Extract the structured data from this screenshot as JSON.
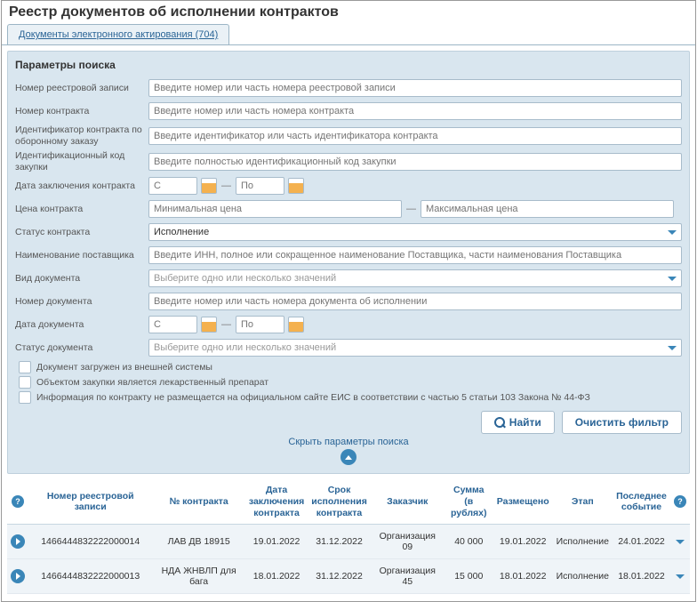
{
  "title": "Реестр документов об исполнении контрактов",
  "tab": "Документы электронного актирования (704)",
  "panel": {
    "title": "Параметры поиска",
    "labels": {
      "registry_no": "Номер реестровой записи",
      "contract_no": "Номер контракта",
      "defense_id": "Идентификатор контракта по оборонному заказу",
      "purchase_id": "Идентификационный код закупки",
      "contract_date": "Дата заключения контракта",
      "price": "Цена контракта",
      "status": "Статус контракта",
      "supplier": "Наименование поставщика",
      "doc_type": "Вид документа",
      "doc_no": "Номер документа",
      "doc_date": "Дата документа",
      "doc_status": "Статус документа"
    },
    "placeholders": {
      "registry_no": "Введите номер или часть номера реестровой записи",
      "contract_no": "Введите номер или часть номера контракта",
      "defense_id": "Введите идентификатор или часть идентификатора контракта",
      "purchase_id": "Введите полностью идентификационный код закупки",
      "date_from": "С",
      "date_to": "По",
      "price_min": "Минимальная цена",
      "price_max": "Максимальная цена",
      "supplier": "Введите ИНН, полное или сокращенное наименование Поставщика, части наименования Поставщика",
      "select_multi": "Выберите одно или несколько значений",
      "doc_no": "Введите номер или часть номера документа об исполнении"
    },
    "status_value": "Исполнение",
    "checkboxes": {
      "external": "Документ загружен из внешней системы",
      "medicine": "Объектом закупки является лекарственный препарат",
      "not_published": "Информация по контракту не размещается на официальном сайте ЕИС в соответствии с частью 5 статьи 103 Закона № 44-ФЗ"
    },
    "buttons": {
      "find": "Найти",
      "clear": "Очистить фильтр"
    },
    "collapse": "Скрыть параметры поиска"
  },
  "table": {
    "headers": {
      "registry": "Номер реестровой записи",
      "contract": "№ контракта",
      "date_concl": "Дата заключения контракта",
      "date_exec": "Срок исполнения контракта",
      "customer": "Заказчик",
      "sum": "Сумма (в рублях)",
      "placed": "Размещено",
      "stage": "Этап",
      "last_event": "Последнее событие"
    },
    "rows": [
      {
        "registry": "1466444832222000014",
        "contract": "ЛАВ ДВ 18915",
        "date_concl": "19.01.2022",
        "date_exec": "31.12.2022",
        "customer": "Организация 09",
        "sum": "40 000",
        "placed": "19.01.2022",
        "stage": "Исполнение",
        "last_event": "24.01.2022"
      },
      {
        "registry": "1466444832222000013",
        "contract": "НДА ЖНВЛП для бага",
        "date_concl": "18.01.2022",
        "date_exec": "31.12.2022",
        "customer": "Организация 45",
        "sum": "15 000",
        "placed": "18.01.2022",
        "stage": "Исполнение",
        "last_event": "18.01.2022"
      }
    ]
  }
}
